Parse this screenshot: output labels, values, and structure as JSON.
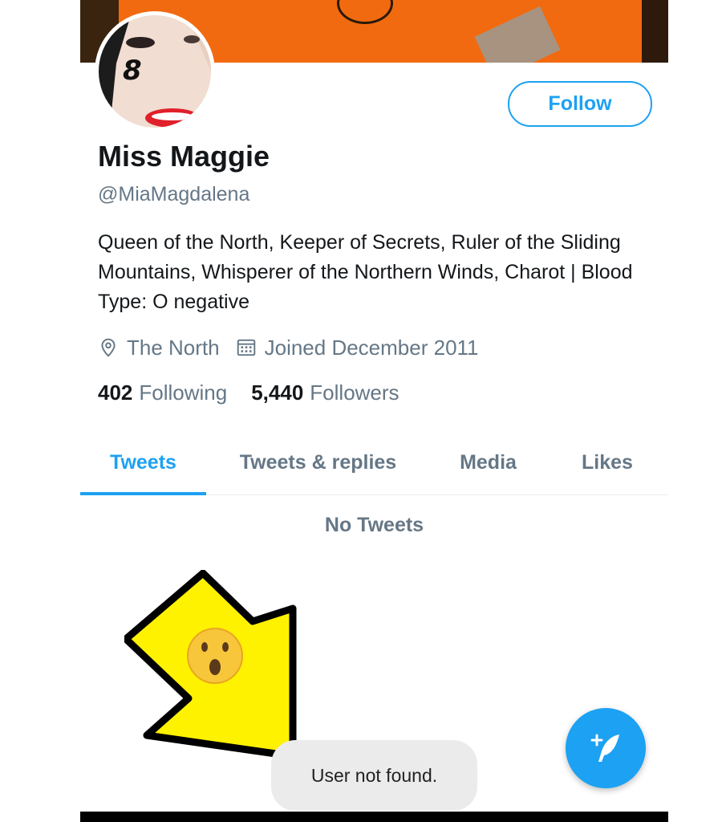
{
  "profile": {
    "display_name": "Miss Maggie",
    "handle": "@MiaMagdalena",
    "bio": "Queen of the North, Keeper of Secrets, Ruler of the Sliding Mountains, Whisperer of the Northern Winds, Charot | Blood Type: O negative",
    "location": "The North",
    "joined": "Joined December 2011",
    "avatar_overlay_text": "8"
  },
  "actions": {
    "follow_label": "Follow"
  },
  "stats": {
    "following_count": "402",
    "following_label": "Following",
    "followers_count": "5,440",
    "followers_label": "Followers"
  },
  "tabs": [
    {
      "label": "Tweets",
      "active": true
    },
    {
      "label": "Tweets & replies",
      "active": false
    },
    {
      "label": "Media",
      "active": false
    },
    {
      "label": "Likes",
      "active": false
    }
  ],
  "timeline": {
    "empty_message": "No Tweets"
  },
  "toast": {
    "message": "User not found."
  },
  "icons": {
    "location": "location-pin-icon",
    "calendar": "calendar-icon",
    "compose": "compose-tweet-icon",
    "annotation": "yellow-arrow-icon",
    "emoji": "astonished-face-emoji"
  },
  "colors": {
    "accent": "#1da1f2",
    "secondary_text": "#657786",
    "primary_text": "#14171a",
    "banner": "#f26a10",
    "arrow_fill": "#fff200"
  }
}
